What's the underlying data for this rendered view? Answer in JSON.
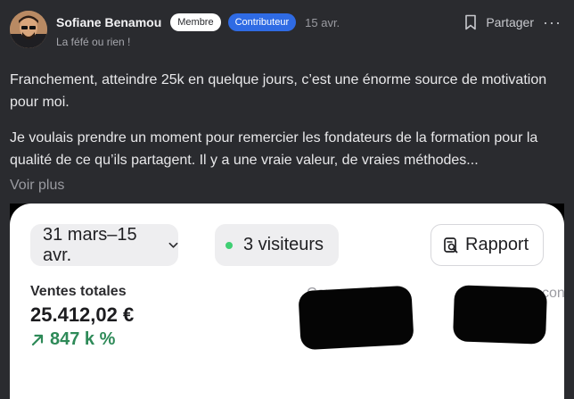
{
  "author": {
    "name": "Sofiane Benamou",
    "badges": [
      "Membre",
      "Contributeur"
    ],
    "date": "15 avr.",
    "subtitle": "La féfé ou rien !"
  },
  "actions": {
    "share_label": "Partager",
    "more_label": "···"
  },
  "post": {
    "paragraphs": [
      "Franchement, atteindre 25k en quelque jours, c’est une énorme source de motivation pour moi.",
      "Je voulais prendre un moment pour remercier les fondateurs de la formation pour la qualité de ce qu’ils partagent. Il y a une vraie valeur, de vraies méthodes..."
    ],
    "see_more": "Voir plus"
  },
  "screenshot": {
    "date_range": "31 mars–15 avr.",
    "visitors": "3 visiteurs",
    "report_label": "Rapport",
    "sales_label": "Ventes totales",
    "sales_value": "25.412,02 €",
    "sales_change": "847 k %",
    "ghost_labels": [
      "Commandes",
      "con"
    ],
    "colors": {
      "visitor_dot": "#3fcf73",
      "growth_green": "#2e8a58",
      "contributor_badge": "#2f6be4"
    }
  }
}
